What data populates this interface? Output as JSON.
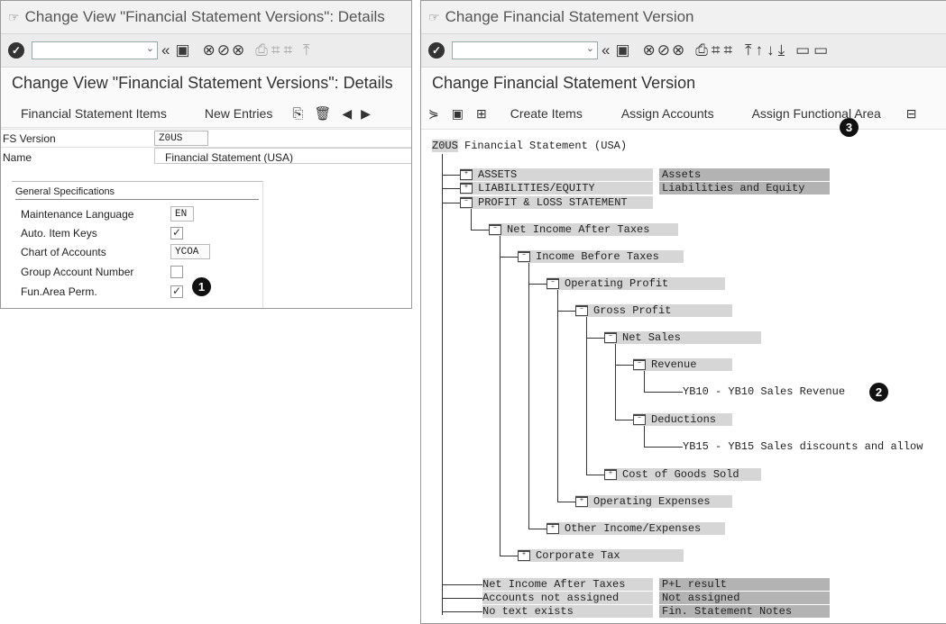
{
  "left": {
    "title": "Change View \"Financial Statement Versions\": Details",
    "page_title": "Change View \"Financial Statement Versions\": Details",
    "app_toolbar": {
      "fs_items": "Financial Statement Items",
      "new_entries": "New Entries"
    },
    "fields": {
      "fs_version_label": "FS Version",
      "fs_version_value": "Z0US",
      "name_label": "Name",
      "name_value": "Financial Statement (USA)"
    },
    "general": {
      "title": "General Specifications",
      "maint_lang_label": "Maintenance Language",
      "maint_lang_value": "EN",
      "auto_keys_label": "Auto. Item Keys",
      "auto_keys_checked": true,
      "coa_label": "Chart of Accounts",
      "coa_value": "YCOA",
      "group_acct_label": "Group Account Number",
      "group_acct_checked": false,
      "funarea_label": "Fun.Area Perm.",
      "funarea_checked": true
    },
    "badge": "1"
  },
  "right": {
    "title": "Change Financial Statement Version",
    "page_title": "Change Financial Statement Version",
    "app_toolbar": {
      "create_items": "Create Items",
      "assign_accounts": "Assign Accounts",
      "assign_functional_area": "Assign Functional Area"
    },
    "tree": {
      "root_code": "Z0US",
      "root_text": "Financial Statement (USA)",
      "assets": "ASSETS",
      "assets_desc": "Assets",
      "liab": "LIABILITIES/EQUITY",
      "liab_desc": "Liabilities and Equity",
      "pl": "PROFIT & LOSS STATEMENT",
      "net_income": "Net Income After Taxes",
      "income_before": "Income Before Taxes",
      "operating_profit": "Operating Profit",
      "gross_profit": "Gross Profit",
      "net_sales": "Net Sales",
      "revenue": "Revenue",
      "yb10": "YB10 - YB10 Sales Revenue",
      "deductions": "Deductions",
      "yb15": "YB15 - YB15 Sales discounts and allow",
      "cogs": "Cost of Goods Sold",
      "opex": "Operating Expenses",
      "other": "Other Income/Expenses",
      "corp_tax": "Corporate Tax",
      "net_income2": "Net Income After Taxes",
      "net_income2_desc": "P+L result",
      "not_assigned": "Accounts not assigned",
      "not_assigned_desc": "Not assigned",
      "no_text": "No text exists",
      "no_text_desc": "Fin. Statement Notes"
    },
    "badge2": "2",
    "badge3": "3"
  }
}
